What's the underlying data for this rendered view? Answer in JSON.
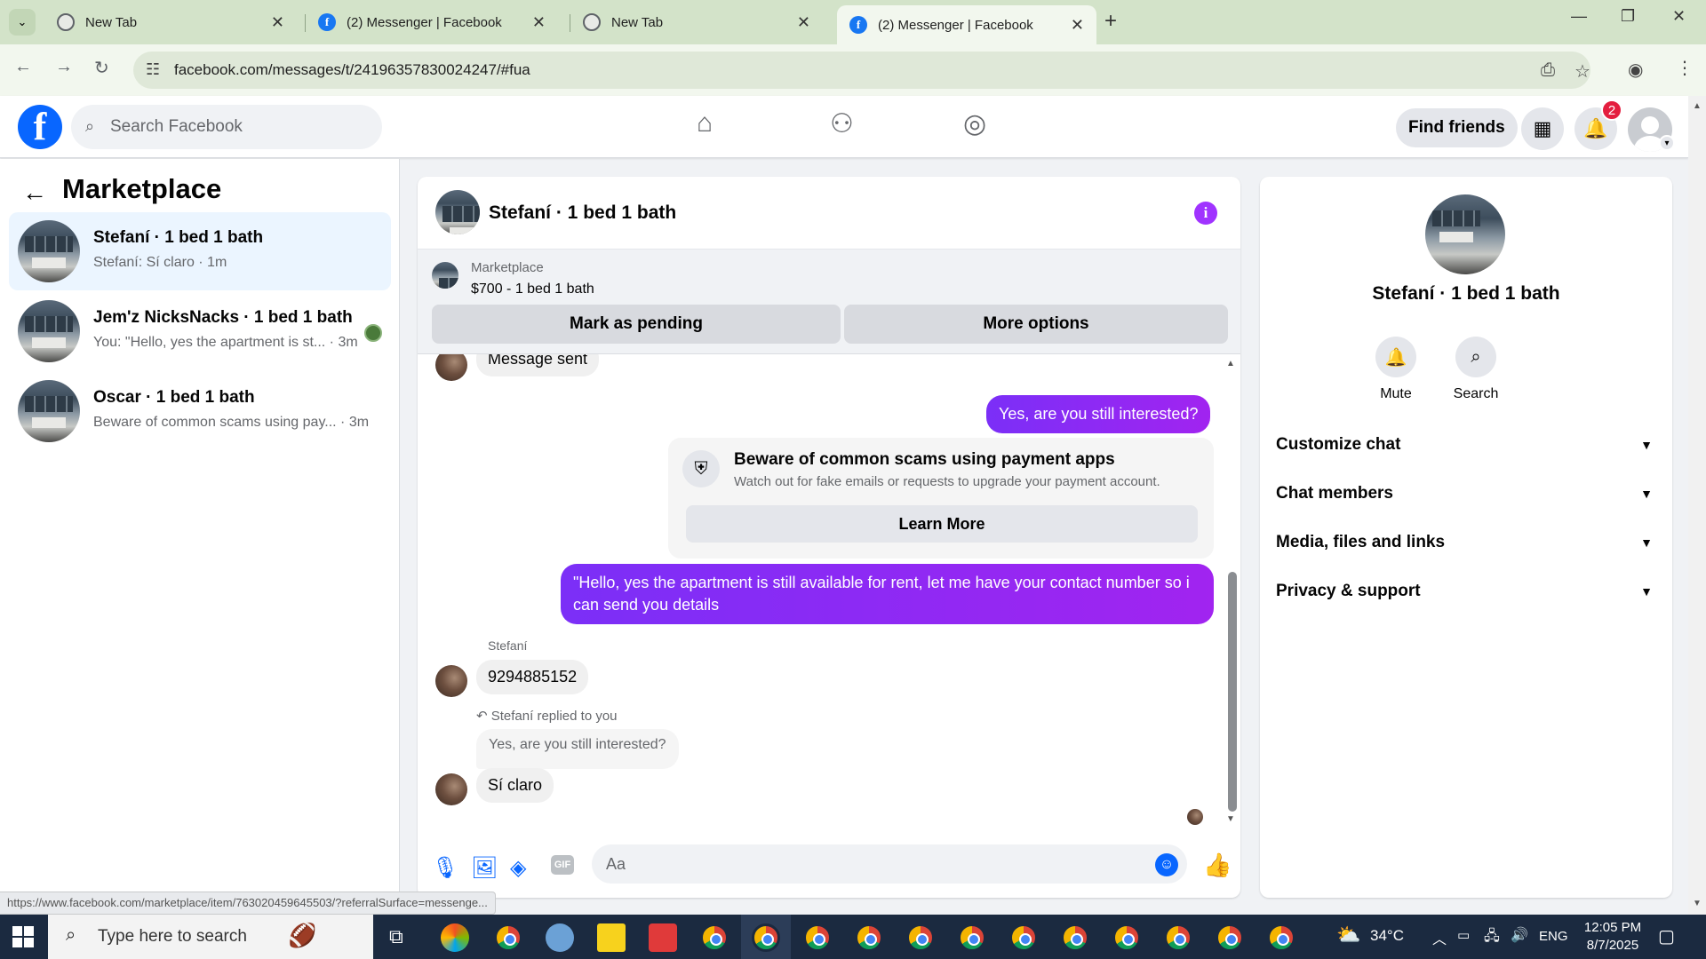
{
  "browser": {
    "tabs": [
      {
        "title": "New Tab",
        "favicon": "chrome-icon"
      },
      {
        "title": "(2) Messenger | Facebook",
        "favicon": "facebook-icon"
      },
      {
        "title": "New Tab",
        "favicon": "chrome-icon"
      },
      {
        "title": "(2) Messenger | Facebook",
        "favicon": "facebook-icon",
        "active": true
      }
    ],
    "url": "facebook.com/messages/t/24196357830024247/#fua"
  },
  "header": {
    "search_placeholder": "Search Facebook",
    "find_friends": "Find friends",
    "notification_count": "2"
  },
  "sidebar": {
    "title": "Marketplace",
    "conversations": [
      {
        "name": "Stefaní · 1 bed 1 bath",
        "preview": "Stefaní: Sí claro · 1m",
        "active": true
      },
      {
        "name": "Jem'z NicksNacks · 1 bed 1 bath",
        "preview": "You: \"Hello, yes the apartment is st... · 3m"
      },
      {
        "name": "Oscar · 1 bed 1 bath",
        "preview": "Beware of common scams using pay... · 3m"
      }
    ]
  },
  "chat": {
    "title": "Stefaní · 1 bed 1 bath",
    "listing": {
      "source": "Marketplace",
      "summary": "$700 - 1 bed 1 bath",
      "mark_pending": "Mark as pending",
      "more_options": "More options"
    },
    "messages": {
      "m1": "Message sent",
      "m2": "Yes, are you still interested?",
      "scam_title": "Beware of common scams using payment apps",
      "scam_body": "Watch out for fake emails or requests to upgrade your payment account.",
      "learn_more": "Learn More",
      "m3": "\"Hello, yes the apartment is still available for rent, let me have your contact number so i can send you details",
      "sender": "Stefaní",
      "m4": "9294885152",
      "reply_label": "Stefaní replied to you",
      "quoted": "Yes, are you still interested?",
      "m5": "Sí claro"
    },
    "composer_placeholder": "Aa"
  },
  "info_panel": {
    "name": "Stefaní · 1 bed 1 bath",
    "mute": "Mute",
    "search": "Search",
    "sections": [
      "Customize chat",
      "Chat members",
      "Media, files and links",
      "Privacy & support"
    ]
  },
  "status_url": "https://www.facebook.com/marketplace/item/763020459645503/?referralSurface=messenge...",
  "taskbar": {
    "search_text": "Type here to search",
    "temperature": "34°C",
    "language": "ENG",
    "time": "12:05 PM",
    "date": "8/7/2025"
  }
}
